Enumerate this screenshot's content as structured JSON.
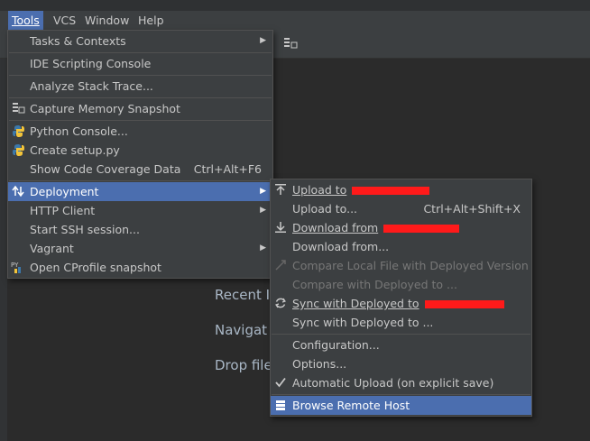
{
  "menubar": {
    "items": [
      {
        "label": "Tools",
        "active": true
      },
      {
        "label": "VCS"
      },
      {
        "label": "Window"
      },
      {
        "label": "Help"
      }
    ]
  },
  "welcome": {
    "recent": "Recent I",
    "navigate": "Navigat",
    "drop": "Drop file"
  },
  "tools_menu": {
    "tasks": "Tasks & Contexts",
    "ide_scripting": "IDE Scripting Console",
    "analyze_stack": "Analyze Stack Trace...",
    "capture_memory": "Capture Memory Snapshot",
    "python_console": "Python Console...",
    "create_setup": "Create setup.py",
    "code_coverage": "Show Code Coverage Data",
    "code_coverage_shortcut": "Ctrl+Alt+F6",
    "deployment": "Deployment",
    "http_client": "HTTP Client",
    "ssh_session": "Start SSH session...",
    "vagrant": "Vagrant",
    "cprofile": "Open CProfile snapshot"
  },
  "deployment_menu": {
    "upload_to": "Upload to",
    "upload_to_dots": "Upload to...",
    "upload_to_shortcut": "Ctrl+Alt+Shift+X",
    "download_from": "Download from",
    "download_from_dots": "Download from...",
    "compare_local": "Compare Local File with Deployed Version",
    "compare_with": "Compare with Deployed to ...",
    "sync_with": "Sync with Deployed to",
    "sync_with_dots": "Sync with Deployed to ...",
    "configuration": "Configuration...",
    "options": "Options...",
    "automatic_upload": "Automatic Upload (on explicit save)",
    "browse_remote": "Browse Remote Host"
  },
  "colors": {
    "highlight": "#4b6eaf",
    "menu_bg": "#3c3f41",
    "redaction": "#ff1a1a"
  }
}
